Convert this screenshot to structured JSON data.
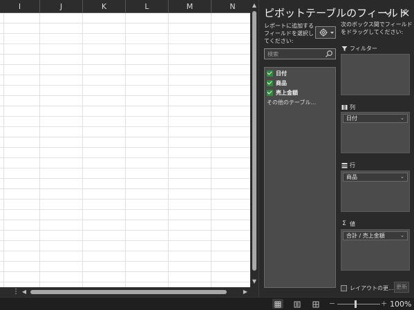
{
  "sheet": {
    "columns": [
      "I",
      "J",
      "K",
      "L",
      "M",
      "N"
    ]
  },
  "pane": {
    "title": "ピボットテーブルのフィールド",
    "choose_fields_hint": "レポートに追加するフィールドを選択してください:",
    "drag_hint": "次のボックス間でフィールドをドラッグしてください:",
    "search_placeholder": "検索",
    "fields": [
      {
        "label": "日付",
        "checked": true
      },
      {
        "label": "商品",
        "checked": true
      },
      {
        "label": "売上金額",
        "checked": true
      }
    ],
    "more_tables": "その他のテーブル...",
    "zones": {
      "filters": {
        "label": "フィルター"
      },
      "columns": {
        "label": "列",
        "chip": "日付"
      },
      "rows": {
        "label": "行",
        "chip": "商品"
      },
      "values": {
        "label": "値",
        "chip": "合計 / 売上金額"
      }
    },
    "defer_label": "レイアウトの更...",
    "update_label": "更新"
  },
  "status": {
    "zoom_percent": "100%",
    "zoom_minus": "−",
    "zoom_plus": "+"
  },
  "colors": {
    "checkbox": "#2f8a3a",
    "pane_bg": "#2a2a2a",
    "zone_bg": "#4b4b4b"
  }
}
